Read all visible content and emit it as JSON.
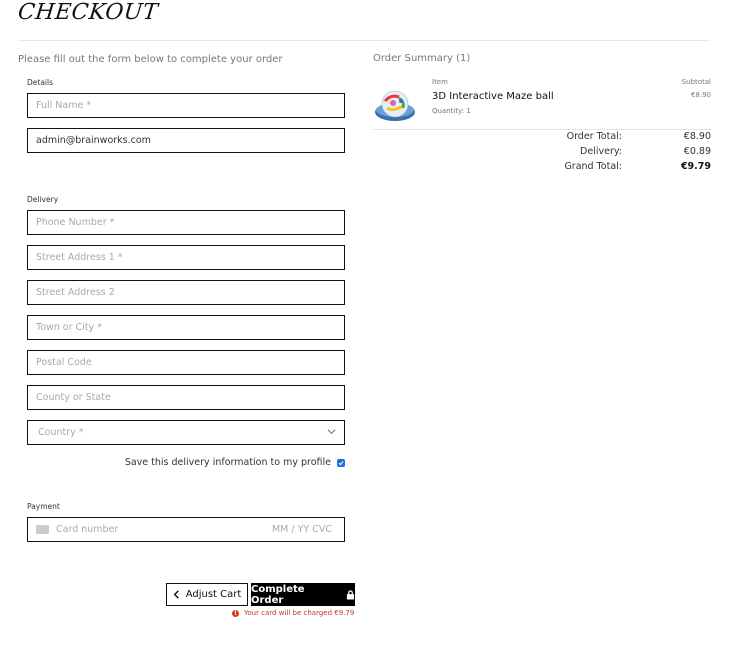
{
  "page_title": "CHECKOUT",
  "intro_text": "Please fill out the form below to complete your order",
  "details": {
    "label": "Details",
    "full_name_placeholder": "Full Name *",
    "email_value": "admin@brainworks.com"
  },
  "delivery": {
    "label": "Delivery",
    "phone_placeholder": "Phone Number *",
    "street1_placeholder": "Street Address 1 *",
    "street2_placeholder": "Street Address 2",
    "town_placeholder": "Town or City *",
    "postal_placeholder": "Postal Code",
    "county_placeholder": "County or State",
    "country_placeholder": "Country *",
    "save_label": "Save this delivery information to my profile",
    "save_checked": true
  },
  "payment": {
    "label": "Payment",
    "card_placeholder": "Card number",
    "expiry_cvc_placeholder": "MM / YY  CVC"
  },
  "buttons": {
    "adjust_cart": "Adjust Cart",
    "complete_order": "Complete Order"
  },
  "charge_notice": "Your card will be charged €9.79",
  "summary": {
    "title": "Order Summary (1)",
    "item_header": "Item",
    "subtotal_header": "Subtotal",
    "product_name": "3D Interactive Maze ball",
    "product_quantity": "Quantity: 1",
    "product_price": "€8.90",
    "order_total_label": "Order Total:",
    "order_total_value": "€8.90",
    "delivery_label": "Delivery:",
    "delivery_value": "€0.89",
    "grand_total_label": "Grand Total:",
    "grand_total_value": "€9.79"
  },
  "icons": {
    "back": "chevron-left-icon",
    "lock": "lock-icon",
    "alert": "alert-circle-icon",
    "dropdown": "chevron-down-icon",
    "card": "credit-card-icon"
  },
  "colors": {
    "accent_checkbox": "#1e6fd9",
    "primary_button": "#000000",
    "error_text": "#c0392b"
  }
}
